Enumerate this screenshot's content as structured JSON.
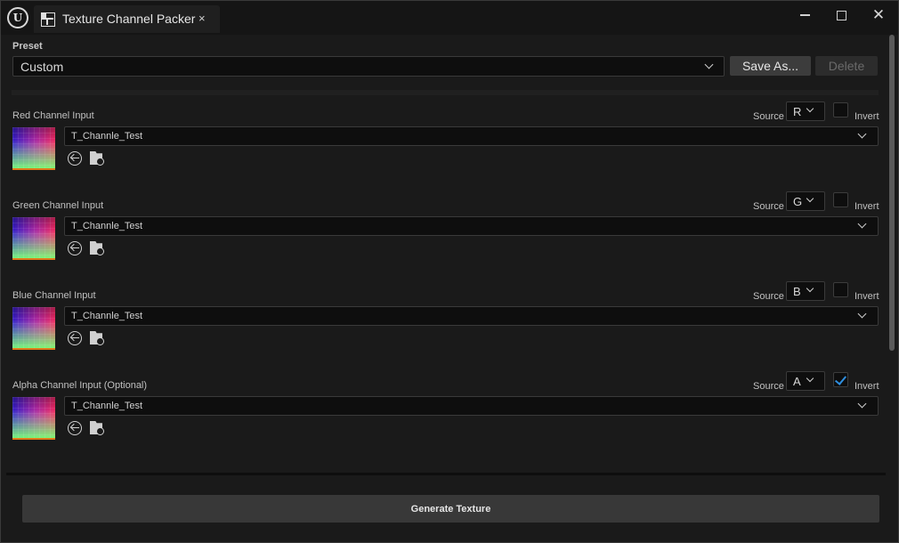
{
  "window": {
    "tab_title": "Texture Channel Packer",
    "tab_close": "×",
    "close_glyph": "✕"
  },
  "preset": {
    "label": "Preset",
    "value": "Custom",
    "save_as_label": "Save As...",
    "delete_label": "Delete"
  },
  "channels": [
    {
      "label": "Red Channel Input",
      "source_label": "Source",
      "source": "R",
      "invert_label": "Invert",
      "invert": false,
      "asset": "T_Channle_Test"
    },
    {
      "label": "Green Channel Input",
      "source_label": "Source",
      "source": "G",
      "invert_label": "Invert",
      "invert": false,
      "asset": "T_Channle_Test"
    },
    {
      "label": "Blue Channel Input",
      "source_label": "Source",
      "source": "B",
      "invert_label": "Invert",
      "invert": false,
      "asset": "T_Channle_Test"
    },
    {
      "label": "Alpha Channel Input (Optional)",
      "source_label": "Source",
      "source": "A",
      "invert_label": "Invert",
      "invert": true,
      "asset": "T_Channle_Test"
    }
  ],
  "footer": {
    "generate_label": "Generate Texture"
  },
  "colors": {
    "accent": "#2f8fe0",
    "thumbnail_underline": "#e07a1a"
  }
}
